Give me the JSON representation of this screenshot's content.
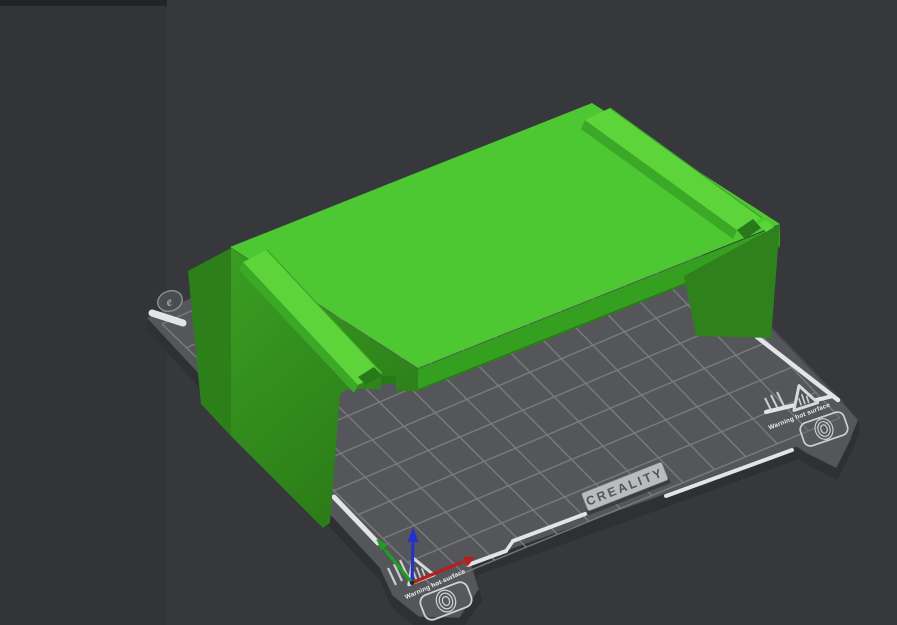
{
  "viewport": {
    "background_color_right": "#37383C",
    "background_color_left": "#333438",
    "top_strip_color": "#232428"
  },
  "build_plate": {
    "brand_label": "CREALITY",
    "surface_color": "#55565A",
    "grid_line_color": "#7E7F83",
    "edge_stripe_color": "#E3E4E5",
    "side_color": "#2F3033",
    "label_bg_color": "#BABBBD",
    "label_text_color": "#54555A",
    "warning_front": {
      "text": "Warning hot surface"
    },
    "warning_right": {
      "text": "Warning hot surface"
    },
    "icons": [
      "warning-triangle-icon",
      "fingerprint-icon",
      "creality-badge-icon"
    ]
  },
  "model": {
    "description": "green rectangular table/bridge model resting on plate",
    "color_top": "#4DC732",
    "color_rail_top": "#5CD43A",
    "color_rail_side": "#3CA827",
    "color_front_band": "#35A01F",
    "color_leg_light": "#3A9E22",
    "color_leg_dark": "#2B7A17",
    "color_leg_side": "#2C7F19",
    "color_right_wall": "#2E811B",
    "color_notch": "#28791A"
  },
  "axis_gizmo": {
    "x_color": "#B51F1F",
    "y_color": "#1E9E22",
    "z_color": "#2531C8"
  }
}
